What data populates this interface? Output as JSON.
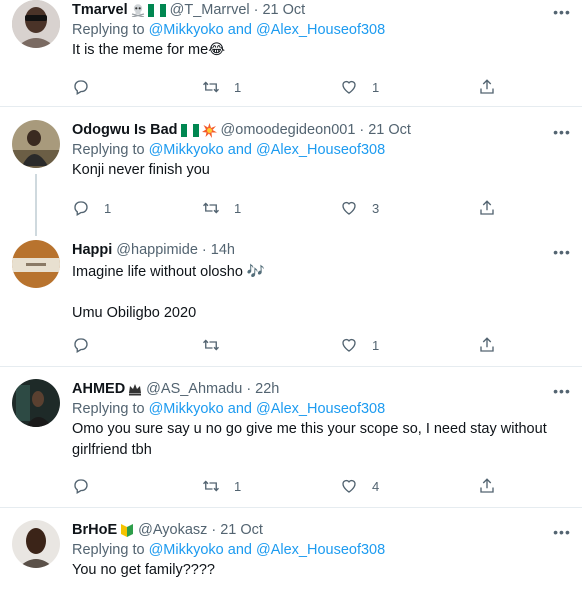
{
  "tweets": [
    {
      "name": "Tmarvel",
      "badges": [
        "skull-crossbones-emoji",
        "nigeria-flag-emoji"
      ],
      "handle": "@T_Marrvel",
      "time": "21 Oct",
      "replying_prefix": "Replying to",
      "mention1": "@Mikkyoko",
      "and": "and",
      "mention2": "@Alex_Houseof308",
      "text": "It is the meme for me😂",
      "text2": "",
      "reply_count": "",
      "retweet_count": "1",
      "like_count": "1"
    },
    {
      "name": "Odogwu Is Bad",
      "badges": [
        "nigeria-flag-emoji",
        "collision-emoji"
      ],
      "handle": "@omoodegideon001",
      "time": "21 Oct",
      "replying_prefix": "Replying to",
      "mention1": "@Mikkyoko",
      "and": "and",
      "mention2": "@Alex_Houseof308",
      "text": "Konji never finish you",
      "text2": "",
      "reply_count": "1",
      "retweet_count": "1",
      "like_count": "3"
    },
    {
      "name": "Happi",
      "badges": [],
      "handle": "@happimide",
      "time": "14h",
      "text": "Imagine life without olosho 🎶",
      "text2": "Umu Obiligbo 2020",
      "reply_count": "",
      "retweet_count": "",
      "like_count": "1"
    },
    {
      "name": "AHMED",
      "badges": [
        "crown-emoji"
      ],
      "handle": "@AS_Ahmadu",
      "time": "22h",
      "replying_prefix": "Replying to",
      "mention1": "@Mikkyoko",
      "and": "and",
      "mention2": "@Alex_Houseof308",
      "text": "Omo you sure say u no go give me this your scope so, I need stay without girlfriend tbh",
      "text2": "",
      "reply_count": "",
      "retweet_count": "1",
      "like_count": "4"
    },
    {
      "name": "BrHoE",
      "badges": [
        "beginner-emoji"
      ],
      "handle": "@Ayokasz",
      "time": "21 Oct",
      "replying_prefix": "Replying to",
      "mention1": "@Mikkyoko",
      "and": "and",
      "mention2": "@Alex_Houseof308",
      "text": "You no get family????",
      "text2": ""
    }
  ],
  "separator_dot": "·",
  "colors": {
    "link": "#1d9bf0",
    "muted": "#536471",
    "divider": "#e6ecf0"
  }
}
